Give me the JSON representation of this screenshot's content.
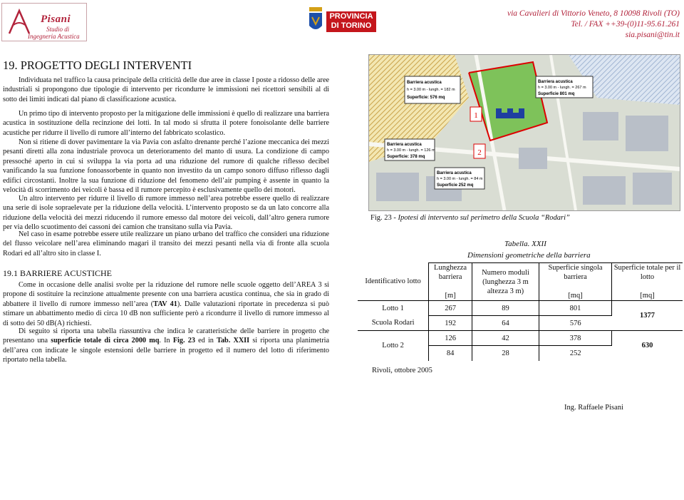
{
  "header": {
    "logo_brand": "Pisani",
    "logo_sub1": "Studio di",
    "logo_sub2": "Ingegneria Acustica",
    "province_logo": "PROVINCIA DI TORINO",
    "address": "via Cavalieri di Vittorio Veneto, 8 10098 Rivoli (TO)",
    "phone": "Tel. / FAX ++39-(0)11-95.61.261",
    "email": "sia.pisani@tin.it"
  },
  "section": {
    "title": "19.  PROGETTO DEGLI INTERVENTI",
    "p1": "Individuata nel traffico la causa principale della criticità delle due aree in classe I poste a ridosso delle aree industriali si propongono due tipologie di intervento per ricondurre le immissioni nei ricettori sensibili al di sotto dei limiti indicati dal piano di classificazione acustica.",
    "p2": "Un primo tipo di intervento proposto per la mitigazione delle immissioni è quello di realizzare una barriera acustica in sostituzione della recinzione dei lotti. In tal modo si sfrutta il potere fonoisolante delle barriere acustiche per ridurre il livello di rumore all’interno del fabbricato scolastico.",
    "p3": "Non si ritiene di dover pavimentare la via Pavia con asfalto drenante perché l’azione meccanica dei mezzi pesanti diretti alla zona industriale provoca un deterioramento del manto di usura. La condizione di campo pressoché aperto in cui si sviluppa la via porta ad una riduzione del rumore di qualche riflesso decibel vanificando la sua funzione fonoassorbente in quanto non investito da un campo sonoro diffuso riflesso dagli edifici circostanti. Inoltre la sua funzione di riduzione del fenomeno dell’air pumping è assente in quanto la velocità di scorrimento dei veicoli è bassa ed il rumore percepito è esclusivamente quello dei motori.",
    "p4": "Un altro intervento per ridurre il livello di rumore immesso nell’area potrebbe essere quello di realizzare una serie di isole sopraelevate per la riduzione della velocità. L’intervento proposto se da un lato concorre alla riduzione della velocità dei mezzi riducendo il rumore emesso dal motore dei veicoli, dall’altro genera rumore per via dello scuotimento dei cassoni dei camion che transitano sulla via Pavia.",
    "p5": "Nel caso in esame potrebbe essere utile realizzare un piano urbano del traffico che consideri una riduzione del flusso veicolare nell’area eliminando magari il transito dei mezzi pesanti nella via di fronte alla scuola Rodari ed all’altro sito in classe I."
  },
  "subsection": {
    "title": "19.1  BARRIERE ACUSTICHE",
    "p1_a": "Come in occasione delle analisi svolte per la riduzione del rumore nelle scuole oggetto dell’AREA 3 si propone di sostituire la recinzione attualmente presente con una barriera acustica continua, che sia in grado di abbattere il livello di rumore immesso nell’area (",
    "p1_bold": "TAV 41",
    "p1_b": "). Dalle valutazioni riportate in precedenza si può stimare un abbattimento medio di circa 10 dB non sufficiente però a ricondurre il livello di rumore immesso al di sotto dei 50 dB(A) richiesti.",
    "p2_a": "Di seguito si riporta una tabella riassuntiva che indica le caratteristiche delle barriere in progetto che presentano una ",
    "p2_bold1": "superficie totale di circa 2000 mq",
    "p2_b": ". In ",
    "p2_bold2": "Fig. 23",
    "p2_c": " ed in ",
    "p2_bold3": "Tab. XXII",
    "p2_d": " si riporta una planimetria dell’area con indicate le singole estensioni delle barriere in progetto ed il numero del lotto di riferimento riportato nella tabella."
  },
  "map": {
    "box1_title": "Barriera acustica",
    "box1_line1": "h = 3.00 m - lungh. = 182 m",
    "box1_line2": "Superficie: 576 mq",
    "box2_title": "Barriera acustica",
    "box2_line1": "h = 3.00 m - lungh. = 267 m",
    "box2_line2": "Superficie 801 mq",
    "box3_title": "Barriera acustica",
    "box3_line1": "h = 3.00 m - lungh. = 126 m",
    "box3_line2": "Superficie: 378 mq",
    "box4_title": "Barriera acustica",
    "box4_line1": "h = 3.00 m - lungh. = 84 m",
    "box4_line2": "Superficie 252 mq",
    "marker1": "1",
    "marker2": "2"
  },
  "figure": {
    "label": "Fig. 23",
    "caption": " - Ipotesi di intervento sul perimetro della Scuola  “Rodari”"
  },
  "table": {
    "title": "Tabella. XXII",
    "subtitle": "Dimensioni geometriche della barriera",
    "headers": [
      "Identificativo lotto",
      "Lunghezza barriera",
      "[m]",
      "Numero moduli (lunghezza 3 m altezza 3 m)",
      "Superficie singola barriera",
      "[mq]",
      "Superficie totale per il lotto",
      "[mq]"
    ],
    "rows": [
      {
        "id": "Lotto 1",
        "len": "267",
        "mod": "89",
        "sup": "801"
      },
      {
        "id": "Scuola Rodari",
        "len": "192",
        "mod": "64",
        "sup": "576"
      },
      {
        "id": "Lotto 2",
        "len": "126",
        "mod": "42",
        "sup": "378"
      },
      {
        "id": "",
        "len": "84",
        "mod": "28",
        "sup": "252"
      }
    ],
    "totals": [
      "1377",
      "630"
    ]
  },
  "footer": {
    "date": "Rivoli, ottobre 2005",
    "signature": "Ing. Raffaele Pisani"
  },
  "colors": {
    "brand_red": "#b2233b",
    "province_red": "#c4161c",
    "barrier_blue": "#1f3fa0"
  }
}
